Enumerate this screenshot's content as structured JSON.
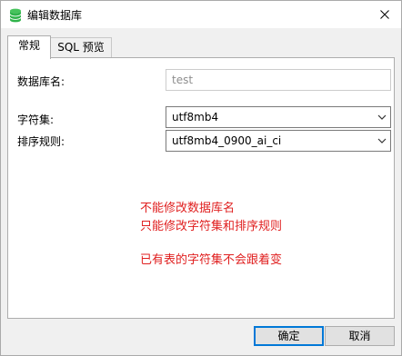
{
  "window": {
    "title": "编辑数据库",
    "icon": "database-icon"
  },
  "tabs": [
    {
      "label": "常规",
      "active": true
    },
    {
      "label": "SQL 预览",
      "active": false
    }
  ],
  "form": {
    "db_name_label": "数据库名:",
    "db_name_value": "test",
    "charset_label": "字符集:",
    "charset_value": "utf8mb4",
    "collation_label": "排序规则:",
    "collation_value": "utf8mb4_0900_ai_ci"
  },
  "notes": [
    "不能修改数据库名",
    "只能修改字符集和排序规则",
    "已有表的字符集不会跟着变"
  ],
  "buttons": {
    "ok": "确定",
    "cancel": "取消"
  },
  "colors": {
    "note": "#e02020",
    "accent": "#0078d7",
    "icon": "#2fb34a"
  }
}
